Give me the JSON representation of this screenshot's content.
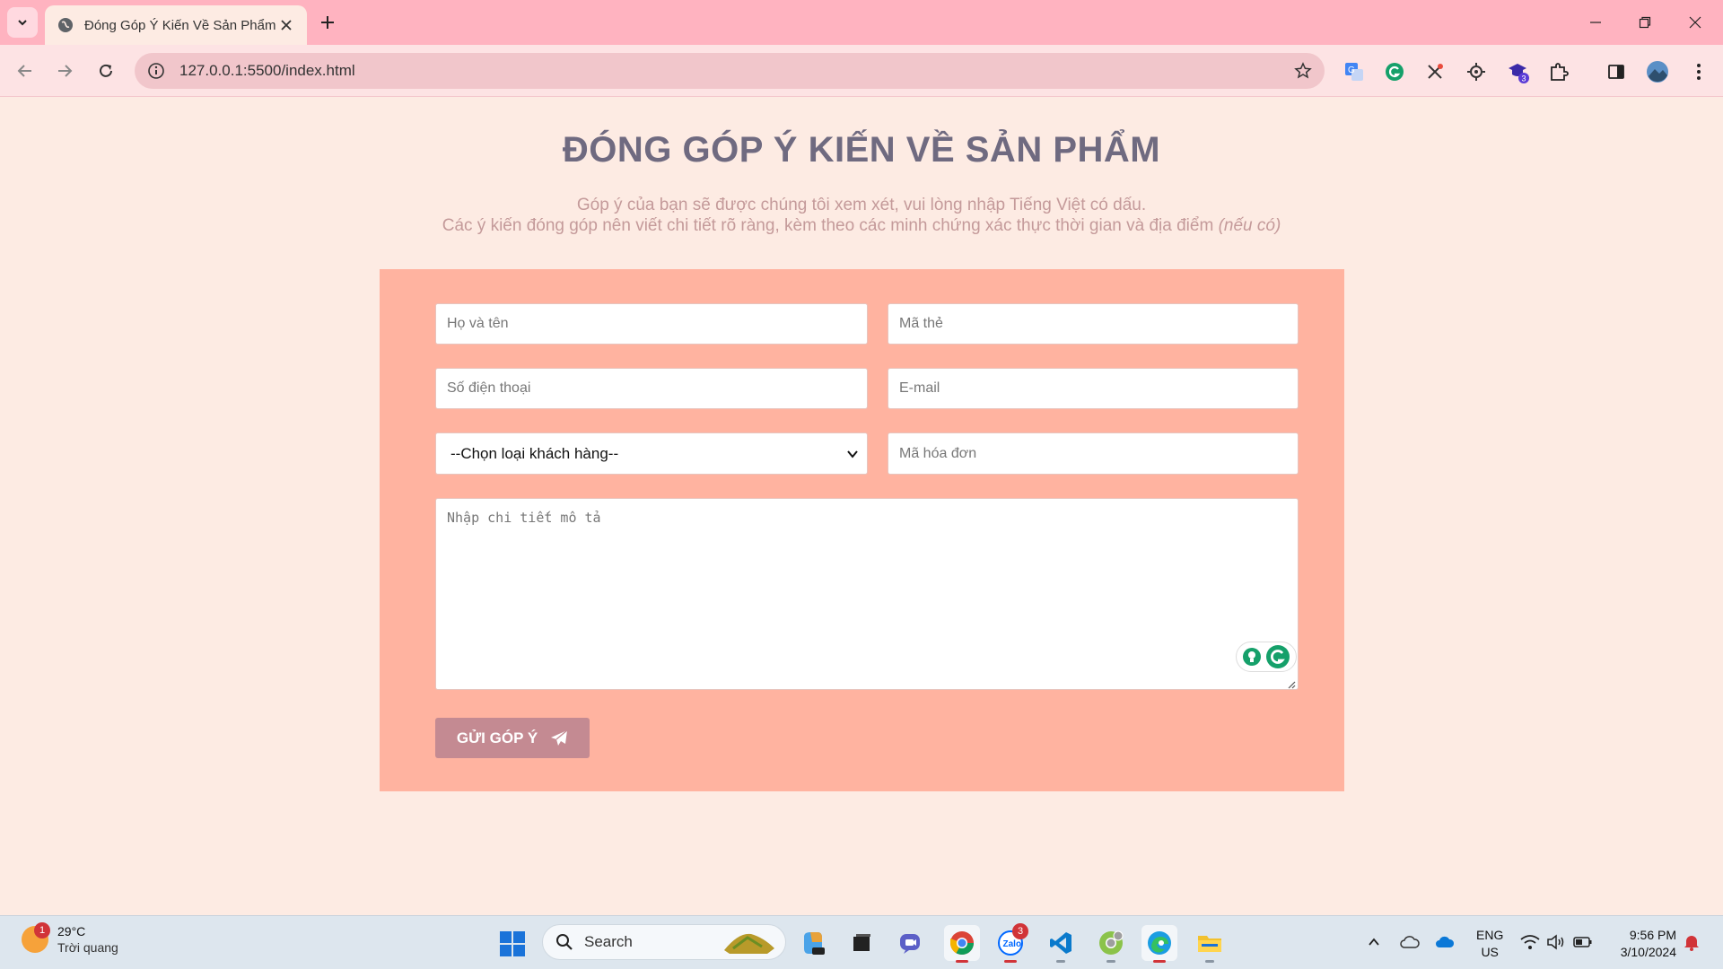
{
  "browser": {
    "tab_title": "Đóng Góp Ý Kiến Về Sản Phẩm",
    "url": "127.0.0.1:5500/index.html",
    "extension_badge": "3"
  },
  "page": {
    "title": "ĐÓNG GÓP Ý KIẾN VỀ SẢN PHẨM",
    "subtitle_line1": "Góp ý của bạn sẽ được chúng tôi xem xét, vui lòng nhập Tiếng Việt có dấu.",
    "subtitle_line2": "Các ý kiến đóng góp nên viết chi tiết rõ ràng, kèm theo các minh chứng xác thực thời gian và địa điểm",
    "subtitle_line2_em": "(nếu có)"
  },
  "form": {
    "name_placeholder": "Họ và tên",
    "card_placeholder": "Mã thẻ",
    "phone_placeholder": "Số điện thoại",
    "email_placeholder": "E-mail",
    "customer_type_selected": "--Chọn loại khách hàng--",
    "invoice_placeholder": "Mã hóa đơn",
    "description_placeholder": "Nhập chi tiết mô tả",
    "submit_label": "GỬI GÓP Ý"
  },
  "colors": {
    "page_bg": "#fdebe3",
    "form_bg": "#ffb3a0",
    "title": "#6f6a80",
    "subtitle": "#c49a9a",
    "button": "#c48a92",
    "tabbar": "#ffb3c0"
  },
  "taskbar": {
    "weather_badge": "1",
    "temperature": "29°C",
    "condition": "Trời quang",
    "search_label": "Search",
    "zalo_badge": "3",
    "lang_line1": "ENG",
    "lang_line2": "US",
    "time": "9:56 PM",
    "date": "3/10/2024"
  }
}
